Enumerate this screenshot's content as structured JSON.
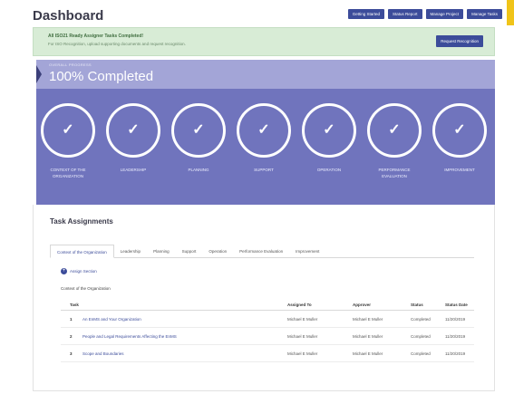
{
  "header": {
    "title": "Dashboard",
    "buttons": [
      "Getting Started",
      "Status Report",
      "Manage Project",
      "Manage Tasks"
    ]
  },
  "alert": {
    "title": "All ISO21 Ready Assigner Tasks Completed!",
    "text": "For ISO Recognition, upload supporting documents and request recognition.",
    "button": "Request Recognition"
  },
  "overall": {
    "label": "OVERALL PROGRESS",
    "value": "100% Completed",
    "progress_percent": 100
  },
  "phases": [
    {
      "label": "CONTEXT OF THE ORGANIZATION",
      "icon": "check-icon"
    },
    {
      "label": "LEADERSHIP",
      "icon": "check-icon"
    },
    {
      "label": "PLANNING",
      "icon": "check-icon"
    },
    {
      "label": "SUPPORT",
      "icon": "check-icon"
    },
    {
      "label": "OPERATION",
      "icon": "check-icon"
    },
    {
      "label": "PERFORMANCE EVALUATION",
      "icon": "check-icon"
    },
    {
      "label": "IMPROVEMENT",
      "icon": "check-icon"
    }
  ],
  "tasks": {
    "title": "Task Assignments",
    "tabs": [
      "Context of the Organization",
      "Leadership",
      "Planning",
      "Support",
      "Operation",
      "Performance Evaluation",
      "Improvement"
    ],
    "active_tab": "Context of the Organization",
    "assign_label": "Assign Section",
    "section_label": "Context of the Organization",
    "columns": [
      "Task",
      "Assigned To",
      "Approver",
      "Status",
      "Status Date"
    ],
    "rows": [
      {
        "num": "1",
        "task": "An EnMS and Your Organization",
        "assigned": "Michael E Muller",
        "approver": "Michael E Muller",
        "status": "Completed",
        "date": "11/20/2019"
      },
      {
        "num": "2",
        "task": "People and Legal Requirements Affecting the EnMS",
        "assigned": "Michael E Muller",
        "approver": "Michael E Muller",
        "status": "Completed",
        "date": "11/20/2019"
      },
      {
        "num": "3",
        "task": "Scope and Boundaries",
        "assigned": "Michael E Muller",
        "approver": "Michael E Muller",
        "status": "Completed",
        "date": "11/20/2019"
      }
    ]
  },
  "colors": {
    "accent": "#3c4c9a",
    "phase_band": "#7074bd",
    "progress_band": "#a3a5d7",
    "alert_bg": "#d8ecd6",
    "corner_tab": "#f0c419"
  }
}
